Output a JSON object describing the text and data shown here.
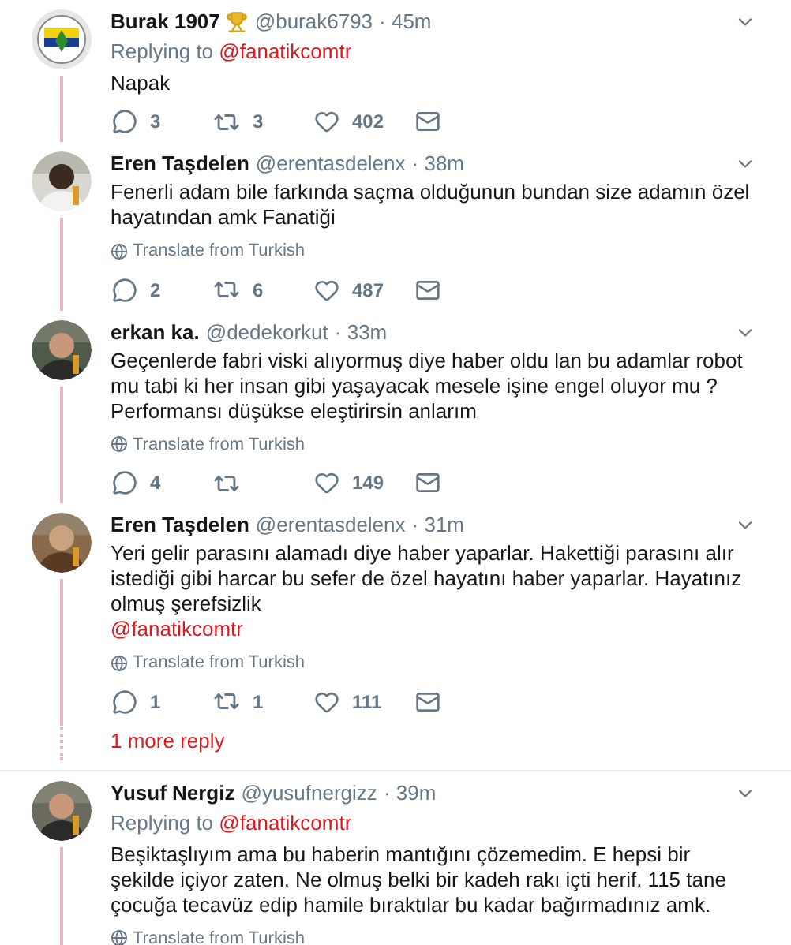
{
  "threads": [
    {
      "tweets": [
        {
          "name": "Burak 1907",
          "trophy": true,
          "handle": "@burak6793",
          "time": "· 45m",
          "replying_label": "Replying to",
          "replying_to": "@fanatikcomtr",
          "text": "Napak",
          "replies": "3",
          "retweets": "3",
          "likes": "402",
          "thread_line": true
        },
        {
          "name": "Eren Taşdelen",
          "handle": "@erentasdelenx",
          "time": "· 38m",
          "text": "Fenerli adam bile farkında saçma olduğunun bundan size adamın özel hayatından amk Fanatiği",
          "translate": "Translate from Turkish",
          "replies": "2",
          "retweets": "6",
          "likes": "487",
          "thread_line": true
        },
        {
          "name": "erkan ka.",
          "handle": "@dedekorkut",
          "time": "· 33m",
          "text": "Geçenlerde fabri viski alıyormuş diye haber oldu lan bu adamlar robot mu tabi ki her insan gibi yaşayacak mesele işine engel oluyor mu ? Performansı düşükse eleştirirsin anlarım",
          "translate": "Translate from Turkish",
          "replies": "4",
          "likes": "149",
          "thread_line": true
        },
        {
          "name": "Eren Taşdelen",
          "handle": "@erentasdelenx",
          "time": "· 31m",
          "text": "Yeri gelir parasını alamadı diye haber yaparlar. Hakettiği parasını alır istediği gibi harcar bu sefer de özel hayatını haber yaparlar. Hayatınız olmuş şerefsizlik",
          "mention": "@fanatikcomtr",
          "translate": "Translate from Turkish",
          "replies": "1",
          "retweets": "1",
          "likes": "111",
          "thread_line": true
        }
      ],
      "more": "1 more reply"
    },
    {
      "tweets": [
        {
          "name": "Yusuf Nergiz",
          "handle": "@yusufnergizz",
          "time": "· 39m",
          "replying_label": "Replying to",
          "replying_to": "@fanatikcomtr",
          "text": "Beşiktaşlıyım ama bu haberin mantığını çözemedim. E hepsi bir şekilde içiyor zaten. Ne olmuş belki bir kadeh rakı içti herif. 115 tane çocuğa tecavüz edip hamile bıraktılar bu kadar bağırmadınız amk.",
          "translate": "Translate from Turkish",
          "thread_line": true
        }
      ]
    }
  ]
}
